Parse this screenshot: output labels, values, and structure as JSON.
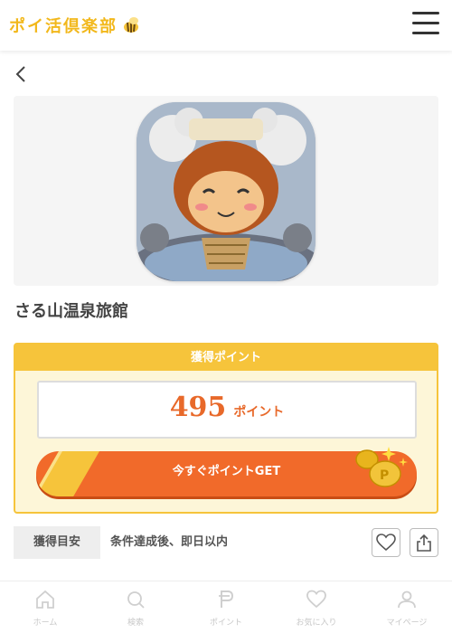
{
  "header": {
    "logo_text": "ポイ活倶楽部",
    "menu_icon": "hamburger-menu-icon"
  },
  "nav": {
    "back_icon": "chevron-left-icon"
  },
  "app": {
    "title": "さる山温泉旅館",
    "icon": "monkey-onsen-app-icon"
  },
  "points": {
    "heading": "獲得ポイント",
    "value": "495",
    "unit": "ポイント",
    "cta_label": "今すぐポイントGET",
    "colors": {
      "accent": "#f16a2a",
      "gold": "#f6c43b"
    }
  },
  "guide": {
    "tag": "獲得目安",
    "text": "条件達成後、即日以内"
  },
  "actions": {
    "favorite_icon": "heart-icon",
    "share_icon": "share-icon"
  },
  "bottom_nav": [
    {
      "label": "ホーム",
      "icon": "home-icon"
    },
    {
      "label": "検索",
      "icon": "search-icon"
    },
    {
      "label": "ポイント",
      "icon": "point-p-icon"
    },
    {
      "label": "お気に入り",
      "icon": "heart-icon"
    },
    {
      "label": "マイページ",
      "icon": "user-icon"
    }
  ]
}
